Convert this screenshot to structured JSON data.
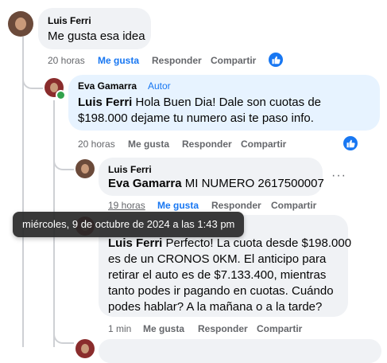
{
  "comments": [
    {
      "author": "Luis Ferri",
      "text": "Me gusta esa idea",
      "time": "20 horas",
      "like_label": "Me gusta",
      "reply_label": "Responder",
      "share_label": "Compartir",
      "liked": true
    },
    {
      "author": "Eva Gamarra",
      "author_badge": "Autor",
      "mention": "Luis Ferri",
      "text_line1": " Hola Buen Dia! Dale son cuotas de",
      "text_line2": "$198.000 dejame tu numero asi te paso info.",
      "time": "20 horas",
      "like_label": "Me gusta",
      "reply_label": "Responder",
      "share_label": "Compartir"
    },
    {
      "author": "Luis Ferri",
      "mention": "Eva Gamarra",
      "text": " MI NUMERO 2617500007",
      "time": "19 horas",
      "like_label": "Me gusta",
      "reply_label": "Responder",
      "share_label": "Compartir",
      "more": "···"
    },
    {
      "mention": "Luis Ferri",
      "text_line1": " Perfecto! La cuota desde $198.000",
      "text_line2": "es de un CRONOS 0KM. El anticipo para",
      "text_line3": "retirar el auto es de $7.133.400, mientras",
      "text_line4": "tanto podes ir pagando en cuotas. Cuándo",
      "text_line5": "podes hablar? A la mañana o a la tarde?",
      "time": "1 min",
      "like_label": "Me gusta",
      "reply_label": "Responder",
      "share_label": "Compartir"
    }
  ],
  "tooltip": "miércoles, 9 de octubre de 2024 a las 1:43 pm",
  "colors": {
    "link_blue": "#1877f2",
    "bubble_gray": "#f0f2f5",
    "author_bubble": "#e7f3ff",
    "meta_gray": "#65676b",
    "online_green": "#31a24c"
  },
  "icons": [
    "thumbs-up-icon",
    "more-options-icon"
  ]
}
